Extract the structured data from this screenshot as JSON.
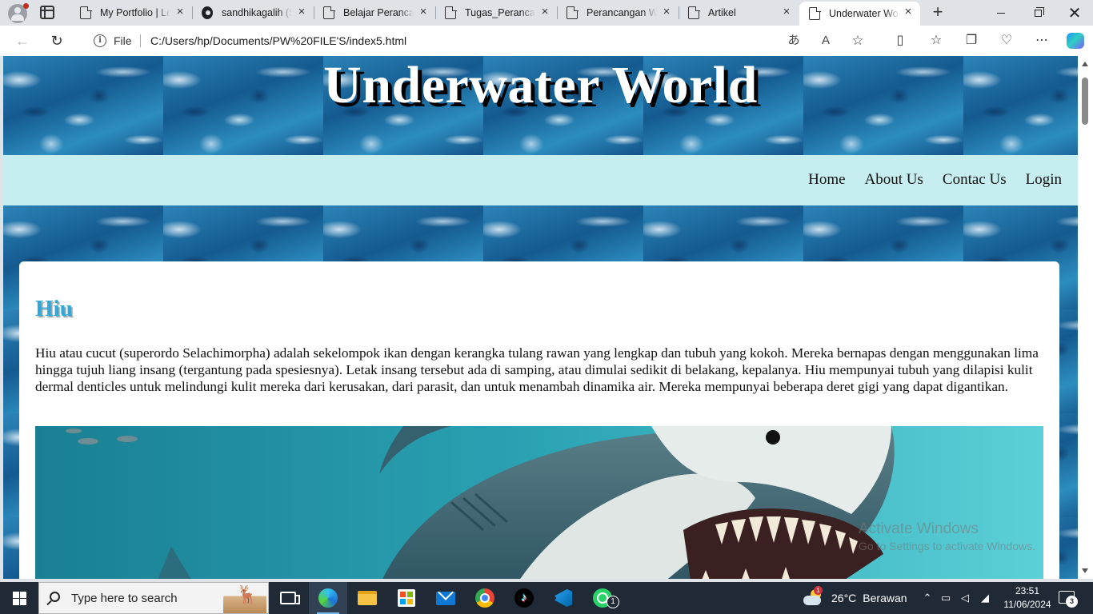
{
  "browser": {
    "tabs": [
      {
        "label": "My Portfolio | Le",
        "favicon": "document-icon",
        "active": false
      },
      {
        "label": "sandhikagalih (S",
        "favicon": "github-icon",
        "active": false
      },
      {
        "label": "Belajar Perancan",
        "favicon": "document-icon",
        "active": false
      },
      {
        "label": "Tugas_Perancang",
        "favicon": "document-icon",
        "active": false
      },
      {
        "label": "Perancangan We",
        "favicon": "document-icon",
        "active": false
      },
      {
        "label": "Artikel",
        "favicon": "document-icon",
        "active": false
      },
      {
        "label": "Underwater Wor",
        "favicon": "document-icon",
        "active": true
      }
    ],
    "address": {
      "scheme_label": "File",
      "url": "C:/Users/hp/Documents/PW%20FILE'S/index5.html"
    }
  },
  "site": {
    "title": "Underwater World",
    "nav": [
      "Home",
      "About Us",
      "Contac Us",
      "Login"
    ],
    "article": {
      "heading": "Hiu",
      "paragraph": "Hiu atau cucut (superordo Selachimorpha) adalah sekelompok ikan dengan kerangka tulang rawan yang lengkap dan tubuh yang kokoh. Mereka bernapas dengan menggunakan lima hingga tujuh liang insang (tergantung pada spesiesnya). Letak insang tersebut ada di samping, atau dimulai sedikit di belakang, kepalanya. Hiu mempunyai tubuh yang dilapisi kulit dermal denticles untuk melindungi kulit mereka dari kerusakan, dari parasit, dan untuk menambah dinamika air. Mereka mempunyai beberapa deret gigi yang dapat digantikan.",
      "image": "shark-illustration"
    },
    "colors": {
      "nav_bg": "#c6eef0",
      "heading": "#31a9d8",
      "header_bg": "#1b6a9c"
    }
  },
  "watermark": {
    "title": "Activate Windows",
    "subtitle": "Go to Settings to activate Windows."
  },
  "taskbar": {
    "search_placeholder": "Type here to search",
    "weather_temp": "26°C",
    "weather_desc": "Berawan",
    "weather_alert": "1",
    "time": "23:51",
    "date": "11/06/2024",
    "whatsapp_badge": "1",
    "notification_count": "3"
  }
}
